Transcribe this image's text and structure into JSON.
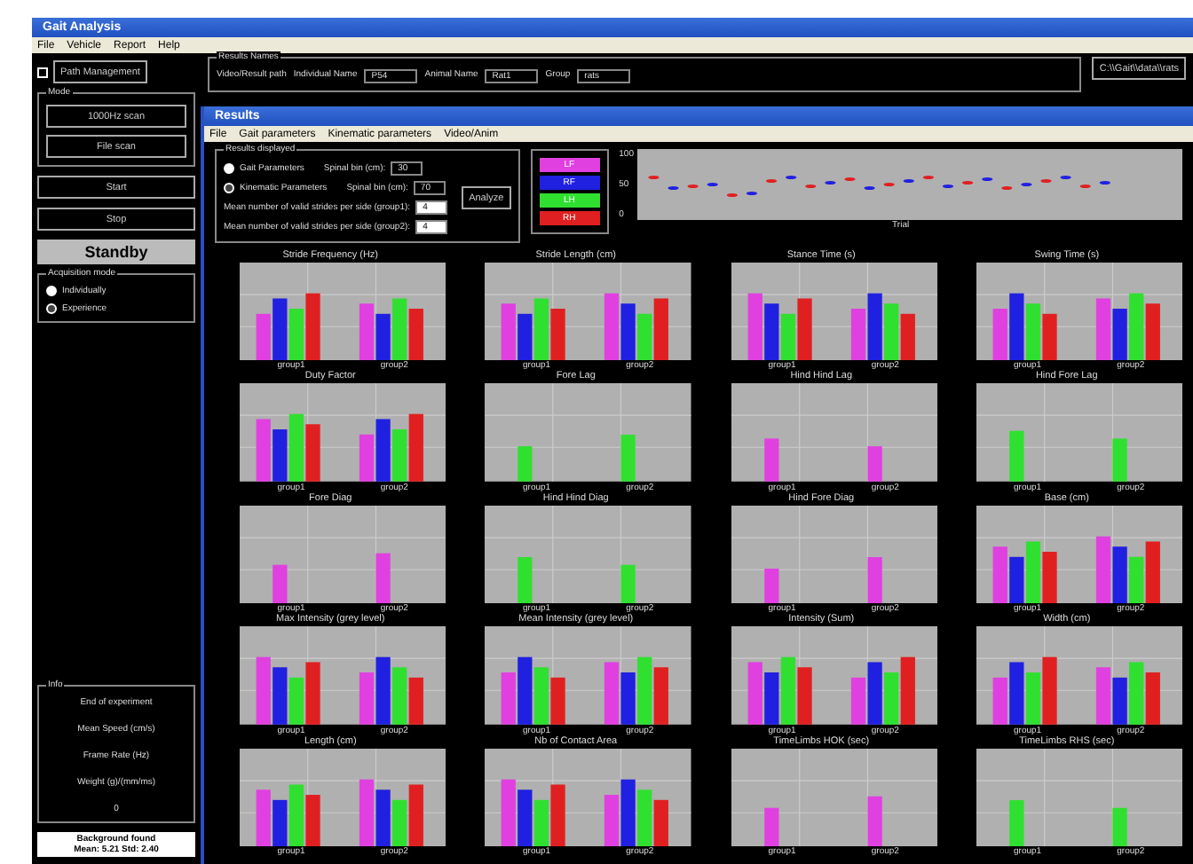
{
  "window": {
    "title": "Gait Analysis"
  },
  "menu": [
    "File",
    "Vehicle",
    "Report",
    "Help"
  ],
  "left_panel": {
    "path_button": "Path Management",
    "checkbox": {
      "checked": false
    },
    "mode_group": {
      "title": "Mode",
      "buttons": [
        "1000Hz scan",
        "File scan"
      ]
    },
    "actions": [
      "Start",
      "Stop"
    ],
    "status": "Standby",
    "acquisition": {
      "title": "Acquisition mode",
      "options": [
        {
          "label": "Individually",
          "selected": true
        },
        {
          "label": "Experience",
          "selected": false
        }
      ]
    },
    "info": {
      "title": "Info",
      "lines": [
        "End of experiment",
        "Mean Speed (cm/s)",
        "Frame Rate (Hz)",
        "Weight (g)/(mm/ms)",
        "0"
      ]
    },
    "background": [
      "Background found",
      "Mean: 5.21 Std: 2.40"
    ]
  },
  "results_names": {
    "title": "Results Names",
    "path_label": "Video/Result path",
    "individual_label": "Individual Name",
    "individual_value": "P54",
    "animal_label": "Animal Name",
    "animal_value": "Rat1",
    "group_label": "Group",
    "group_value": "rats",
    "path_value": "C:\\\\Gait\\\\data\\\\rats"
  },
  "results": {
    "title": "Results",
    "menu": [
      "File",
      "Gait parameters",
      "Kinematic parameters",
      "Video/Anim"
    ],
    "displayed": {
      "title": "Results displayed",
      "options": [
        {
          "label": "Gait Parameters",
          "selected": true
        },
        {
          "label": "Kinematic Parameters",
          "selected": false
        }
      ],
      "bins": [
        {
          "label": "Spinal bin (cm):",
          "value": "30"
        },
        {
          "label": "Spinal bin (cm):",
          "value": "70"
        }
      ],
      "strides": [
        {
          "label": "Mean number of valid strides per side (group1):",
          "value": "4"
        },
        {
          "label": "Mean number of valid strides per side (group2):",
          "value": "4"
        }
      ],
      "analyze": "Analyze"
    },
    "legend": [
      {
        "label": "LF",
        "color": "#e040e0"
      },
      {
        "label": "RF",
        "color": "#2020e0"
      },
      {
        "label": "LH",
        "color": "#30e030"
      },
      {
        "label": "RH",
        "color": "#e02020"
      }
    ],
    "trial_plot": {
      "yticks": [
        "100",
        "50",
        "0"
      ],
      "xlabel": "Trial"
    },
    "charts": [
      {
        "title": "Stride Frequency (Hz)",
        "kind": "four",
        "groups": [
          "group1",
          "group2"
        ]
      },
      {
        "title": "Stride Length (cm)",
        "kind": "four",
        "groups": [
          "group1",
          "group2"
        ]
      },
      {
        "title": "Stance Time (s)",
        "kind": "four",
        "groups": [
          "group1",
          "group2"
        ]
      },
      {
        "title": "Swing Time (s)",
        "kind": "four",
        "groups": [
          "group1",
          "group2"
        ]
      },
      {
        "title": "Duty Factor",
        "kind": "four",
        "groups": [
          "group1",
          "group2"
        ]
      },
      {
        "title": "Fore Lag",
        "kind": "single",
        "groups": [
          "group1",
          "group2"
        ]
      },
      {
        "title": "Hind Hind Lag",
        "kind": "single",
        "groups": [
          "group1",
          "group2"
        ]
      },
      {
        "title": "Hind Fore Lag",
        "kind": "single",
        "groups": [
          "group1",
          "group2"
        ]
      },
      {
        "title": "Fore Diag",
        "kind": "single",
        "groups": [
          "group1",
          "group2"
        ]
      },
      {
        "title": "Hind Hind Diag",
        "kind": "single",
        "groups": [
          "group1",
          "group2"
        ]
      },
      {
        "title": "Hind Fore Diag",
        "kind": "single",
        "groups": [
          "group1",
          "group2"
        ]
      },
      {
        "title": "Base (cm)",
        "kind": "four",
        "groups": [
          "group1",
          "group2"
        ]
      },
      {
        "title": "Max Intensity (grey level)",
        "kind": "four",
        "groups": [
          "group1",
          "group2"
        ]
      },
      {
        "title": "Mean Intensity (grey level)",
        "kind": "four",
        "groups": [
          "group1",
          "group2"
        ]
      },
      {
        "title": "Intensity (Sum)",
        "kind": "four",
        "groups": [
          "group1",
          "group2"
        ]
      },
      {
        "title": "Width (cm)",
        "kind": "four",
        "groups": [
          "group1",
          "group2"
        ]
      },
      {
        "title": "Length (cm)",
        "kind": "four",
        "groups": [
          "group1",
          "group2"
        ]
      },
      {
        "title": "Nb of Contact Area",
        "kind": "four",
        "groups": [
          "group1",
          "group2"
        ]
      },
      {
        "title": "TimeLimbs HOK (sec)",
        "kind": "single",
        "groups": [
          "group1",
          "group2"
        ]
      },
      {
        "title": "TimeLimbs RHS (sec)",
        "kind": "single",
        "groups": [
          "group1",
          "group2"
        ]
      }
    ]
  }
}
